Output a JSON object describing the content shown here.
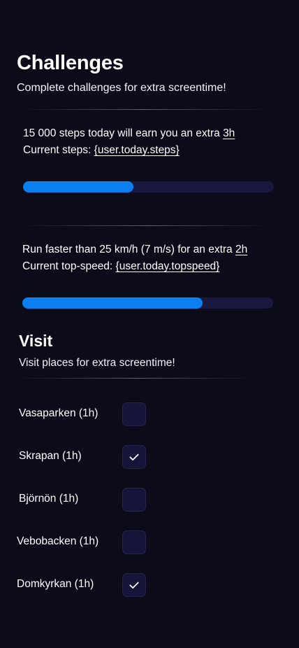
{
  "challenges": {
    "title": "Challenges",
    "subtitle": "Complete challenges for extra screentime!",
    "items": [
      {
        "prefix": "15 000 steps today will earn you an extra ",
        "reward": "3h",
        "current_label": "Current steps: ",
        "current_value": "{user.today.steps}",
        "progress": 0.44
      },
      {
        "prefix": "Run faster than 25 km/h (7 m/s) for an extra ",
        "reward": "2h",
        "current_label": "Current top-speed: ",
        "current_value": "{user.today.topspeed}",
        "progress": 0.72
      }
    ]
  },
  "visit": {
    "title": "Visit",
    "subtitle": "Visit places for extra screentime!",
    "places": [
      {
        "label": "Vasaparken (1h)",
        "checked": false
      },
      {
        "label": "Skrapan (1h)",
        "checked": true
      },
      {
        "label": "Björnön (1h)",
        "checked": false
      },
      {
        "label": "Vebobacken (1h)",
        "checked": false
      },
      {
        "label": "Domkyrkan (1h)",
        "checked": true
      }
    ]
  },
  "colors": {
    "background": "#0b0b19",
    "progress_fill": "#0a7ff0",
    "progress_track": "#181840",
    "checkbox_bg": "#15153a"
  },
  "icons": {
    "check": "check-icon"
  }
}
